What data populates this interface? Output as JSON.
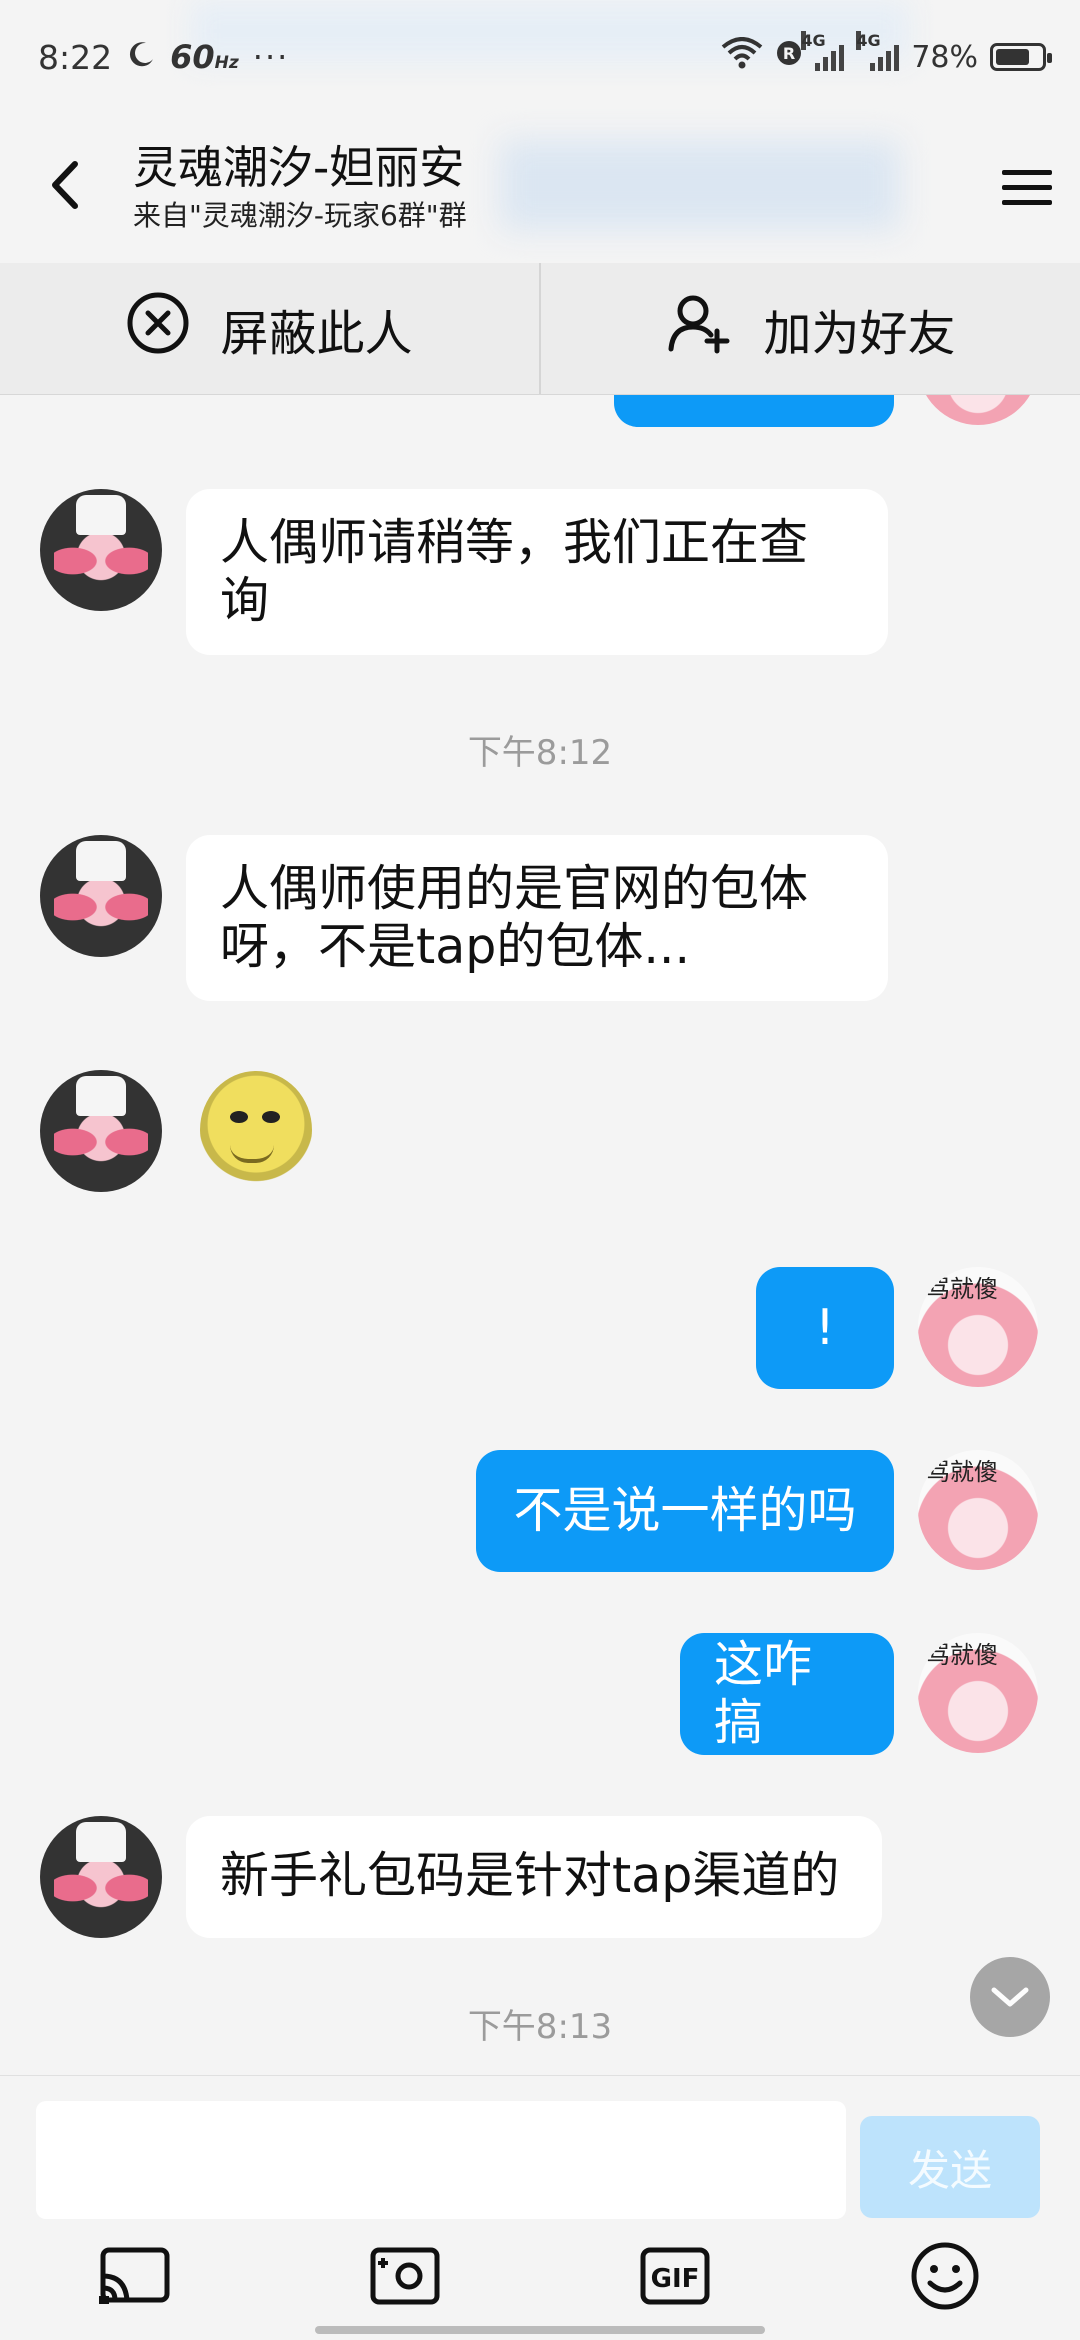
{
  "status_bar": {
    "time": "8:22",
    "refresh_rate": "60",
    "refresh_unit": "Hz",
    "more": "···",
    "network_1": "4G",
    "network_2": "4G",
    "battery_percent": "78%",
    "battery_level": 0.78,
    "icons": [
      "moon-icon",
      "wifi-icon",
      "roaming-icon",
      "signal-icon",
      "battery-icon"
    ]
  },
  "header": {
    "title": "灵魂潮汐-妲丽安",
    "subtitle": "来自\"灵魂潮汐-玩家6群\"群",
    "back_icon": "back-arrow-icon",
    "menu_icon": "menu-icon"
  },
  "actions": {
    "block_label": "屏蔽此人",
    "add_friend_label": "加为好友"
  },
  "messages": [
    {
      "side": "right",
      "type": "text",
      "text": ""
    },
    {
      "side": "left",
      "type": "text",
      "text": "人偶师请稍等，我们正在查询"
    },
    {
      "type": "time",
      "text": "下午8:12"
    },
    {
      "side": "left",
      "type": "text",
      "text": "人偶师使用的是官网的包体呀，不是tap的包体..."
    },
    {
      "side": "left",
      "type": "sticker",
      "text": ""
    },
    {
      "side": "right",
      "type": "text",
      "text": "!"
    },
    {
      "side": "right",
      "type": "text",
      "text": "不是说一样的吗"
    },
    {
      "side": "right",
      "type": "text",
      "text": "这咋搞"
    },
    {
      "side": "left",
      "type": "text",
      "text": "新手礼包码是针对tap渠道的"
    },
    {
      "type": "time",
      "text": "下午8:13"
    }
  ],
  "my_avatar_caption": "骂就傻",
  "composer": {
    "input_value": "",
    "send_label": "发送",
    "tools": [
      "cast-screen-icon",
      "photo-camera-icon",
      "gif-icon",
      "emoji-icon"
    ],
    "gif_label": "GIF"
  },
  "colors": {
    "accent": "#0d9af7",
    "send_disabled": "#bde3fc",
    "background": "#f4f4f4"
  }
}
